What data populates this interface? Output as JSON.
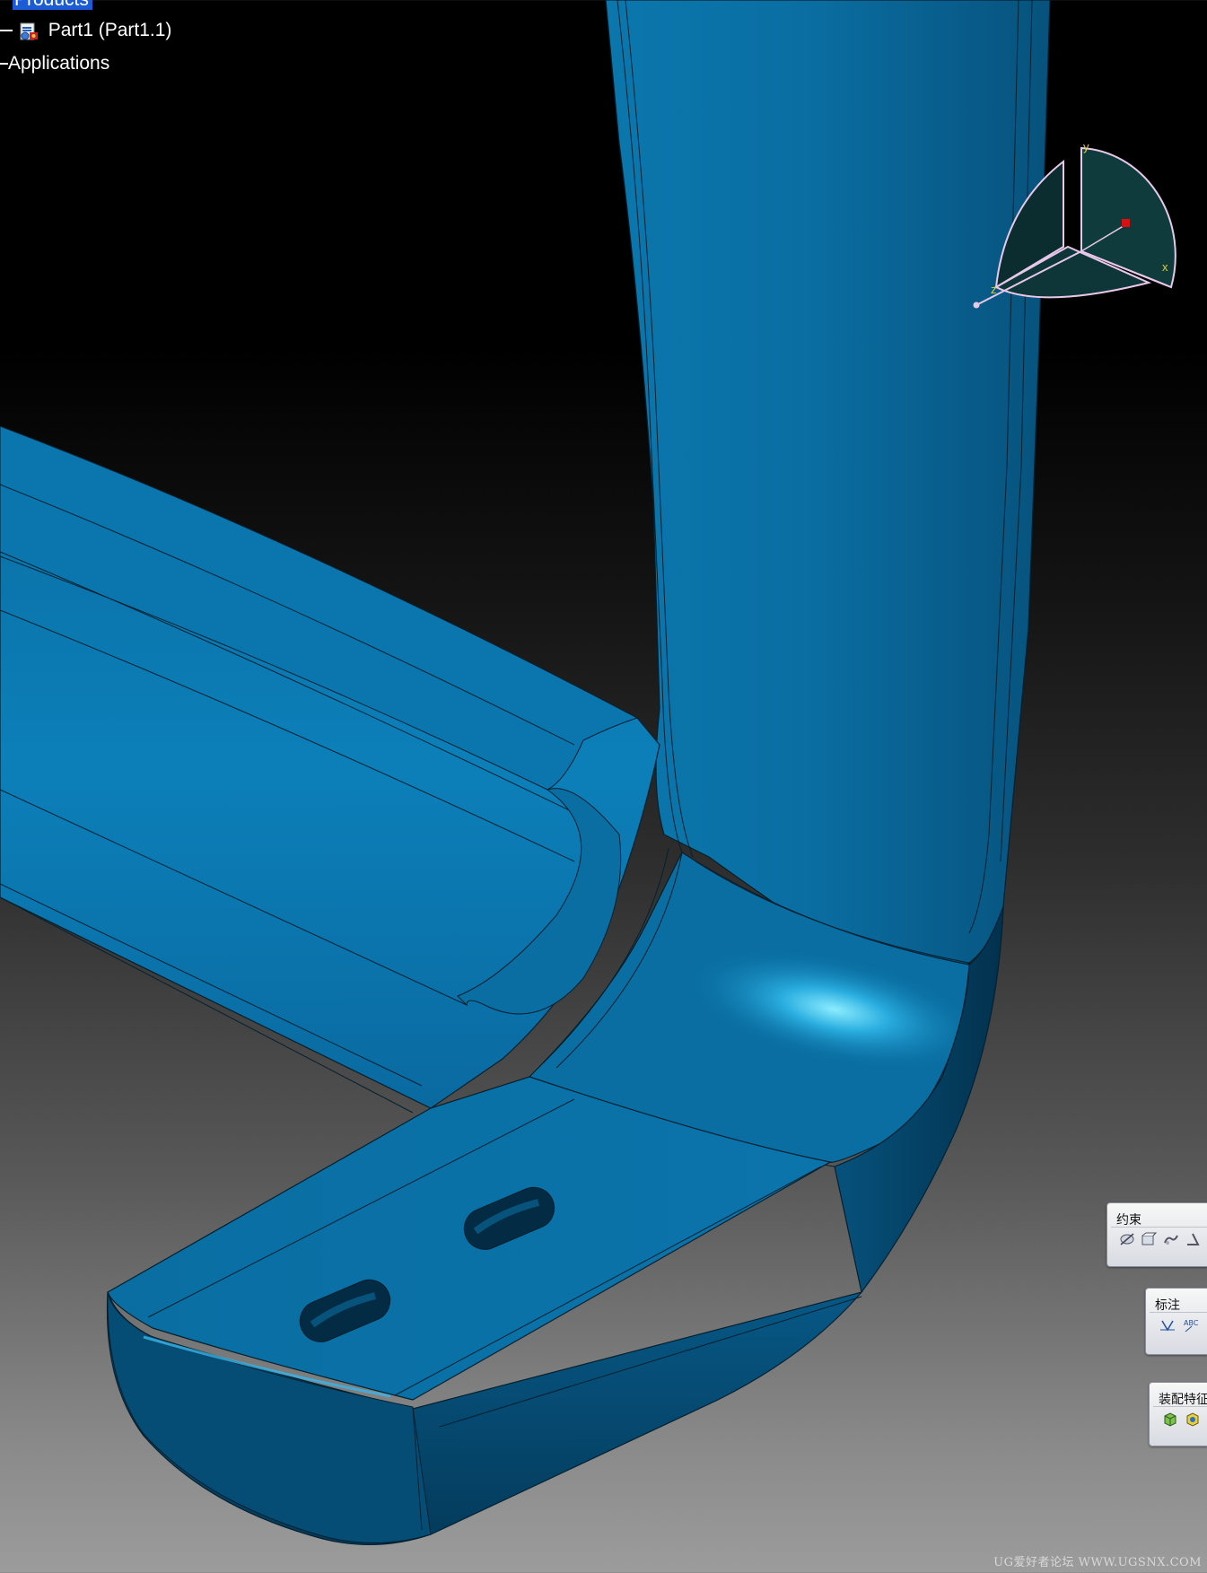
{
  "tree": {
    "root_label": "Products",
    "part_label": "Part1 (Part1.1)",
    "applications_label": "Applications"
  },
  "compass": {
    "x_label": "x",
    "y_label": "y",
    "z_label": "z"
  },
  "toolbars": [
    {
      "title": "约束",
      "icons": [
        "coincidence-constraint-icon",
        "contact-constraint-icon",
        "offset-constraint-icon",
        "angle-constraint-icon"
      ]
    },
    {
      "title": "标注",
      "icons": [
        "weld-feature-icon",
        "text-annotation-icon"
      ]
    },
    {
      "title": "装配特征",
      "icons": [
        "split-assembly-icon",
        "hole-assembly-icon"
      ]
    }
  ],
  "watermark": "UG爱好者论坛 WWW.UGSNX.COM",
  "colors": {
    "part_blue": "#0a6fa3",
    "part_dark": "#053f61",
    "part_highlight": "#7fe3ff",
    "edge_line": "#04202f",
    "selection": "#1c5bd6",
    "compass_fill": "#0f3b3d"
  }
}
